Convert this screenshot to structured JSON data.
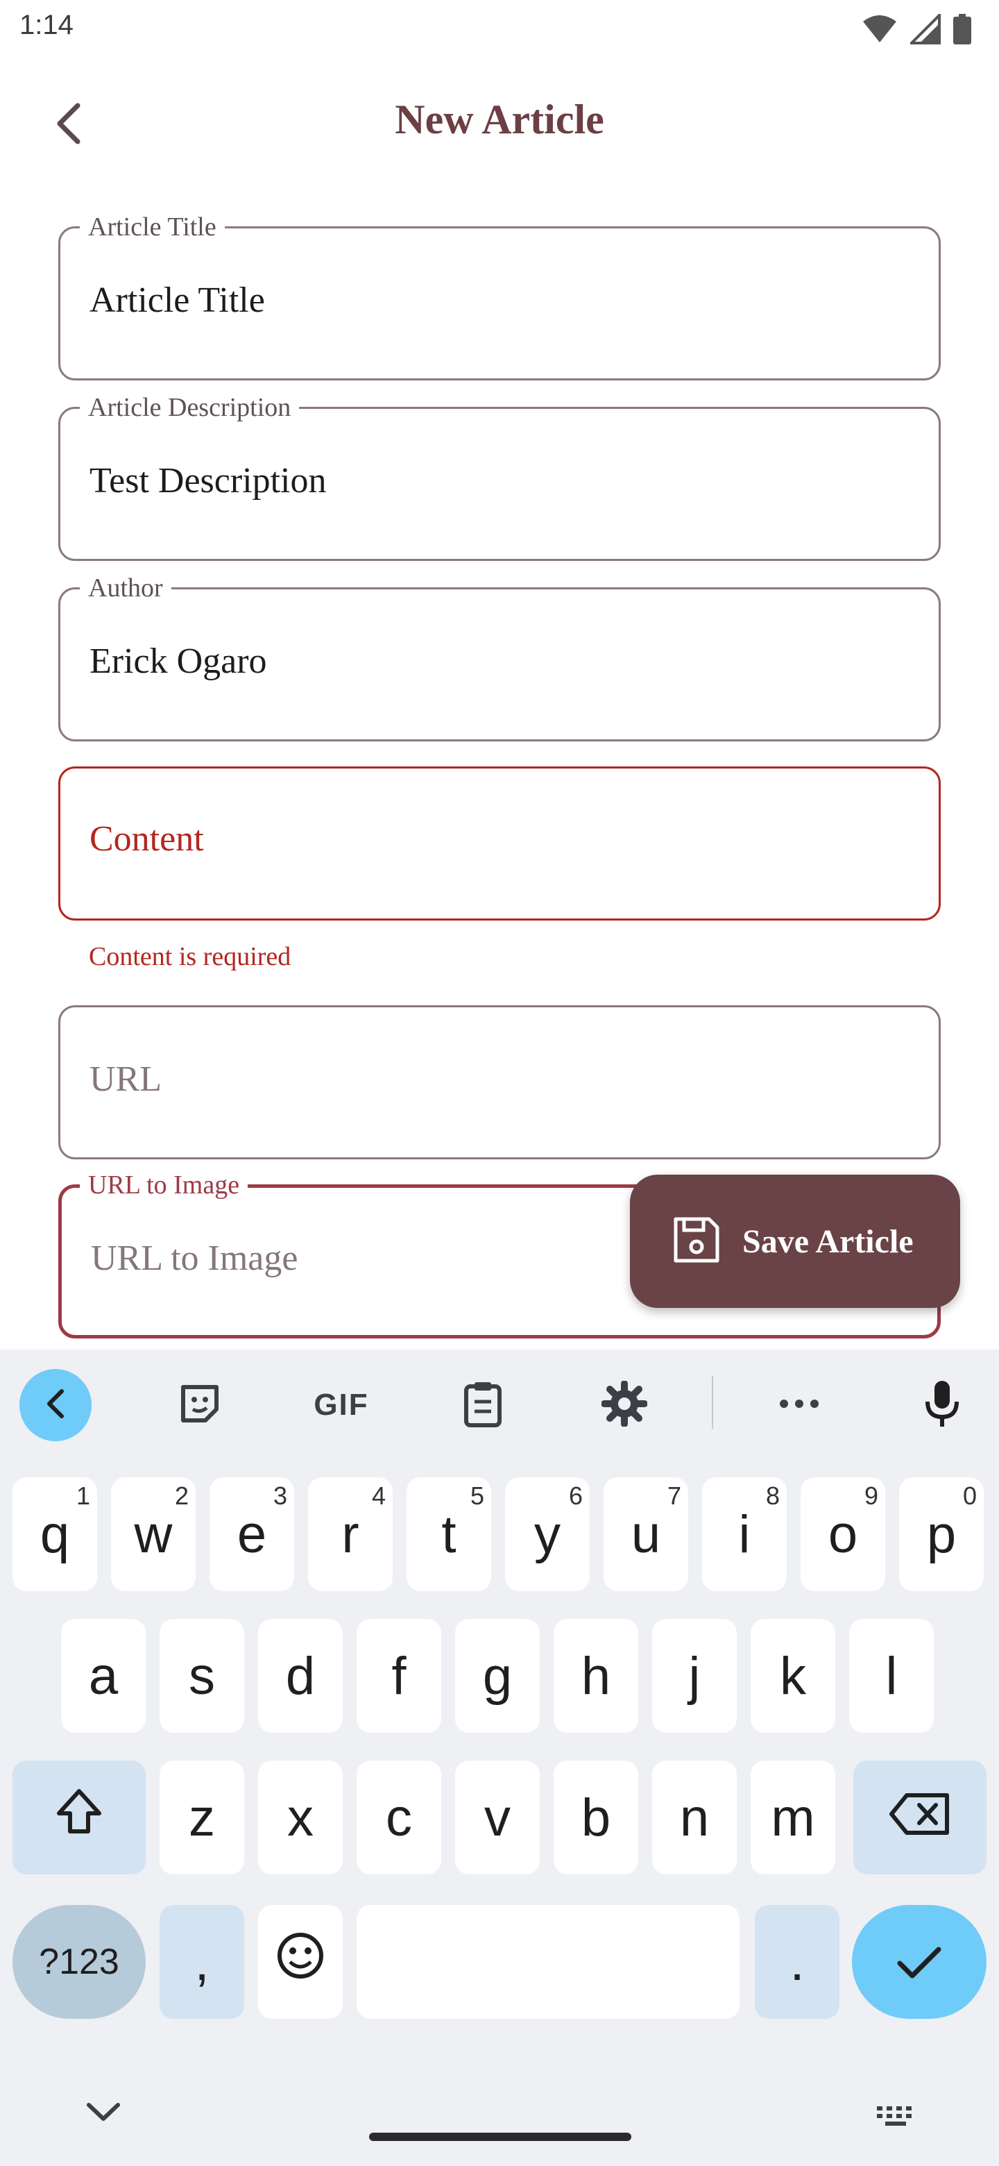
{
  "status_bar": {
    "time": "1:14"
  },
  "header": {
    "title": "New Article"
  },
  "form": {
    "fields": [
      {
        "label": "Article Title",
        "value": "Article Title"
      },
      {
        "label": "Article Description",
        "value": "Test Description"
      },
      {
        "label": "Author",
        "value": "Erick Ogaro"
      },
      {
        "label": "",
        "value": "Content",
        "error": "Content is required"
      },
      {
        "label": "",
        "value": "URL"
      },
      {
        "label": "URL to Image",
        "value": "URL to Image"
      }
    ]
  },
  "fab": {
    "label": "Save Article",
    "icon": "save-icon"
  },
  "keyboard": {
    "toolbar": [
      "back-icon",
      "sticker-icon",
      "GIF",
      "clipboard-icon",
      "settings-icon",
      "more-icon",
      "mic-icon"
    ],
    "row1": [
      {
        "key": "q",
        "sup": "1"
      },
      {
        "key": "w",
        "sup": "2"
      },
      {
        "key": "e",
        "sup": "3"
      },
      {
        "key": "r",
        "sup": "4"
      },
      {
        "key": "t",
        "sup": "5"
      },
      {
        "key": "y",
        "sup": "6"
      },
      {
        "key": "u",
        "sup": "7"
      },
      {
        "key": "i",
        "sup": "8"
      },
      {
        "key": "o",
        "sup": "9"
      },
      {
        "key": "p",
        "sup": "0"
      }
    ],
    "row2": [
      "a",
      "s",
      "d",
      "f",
      "g",
      "h",
      "j",
      "k",
      "l"
    ],
    "row3": [
      "z",
      "x",
      "c",
      "v",
      "b",
      "n",
      "m"
    ],
    "row4": {
      "symbols": "?123",
      "comma": ",",
      "period": "."
    },
    "colors": {
      "accent": "#6fcbf7",
      "modifier": "#d3e3f2",
      "background": "#eef0f4"
    }
  },
  "colors": {
    "title": "#6b3f43",
    "error": "#b3261e",
    "fab": "#6a4346",
    "focus": "#9d3a44"
  }
}
